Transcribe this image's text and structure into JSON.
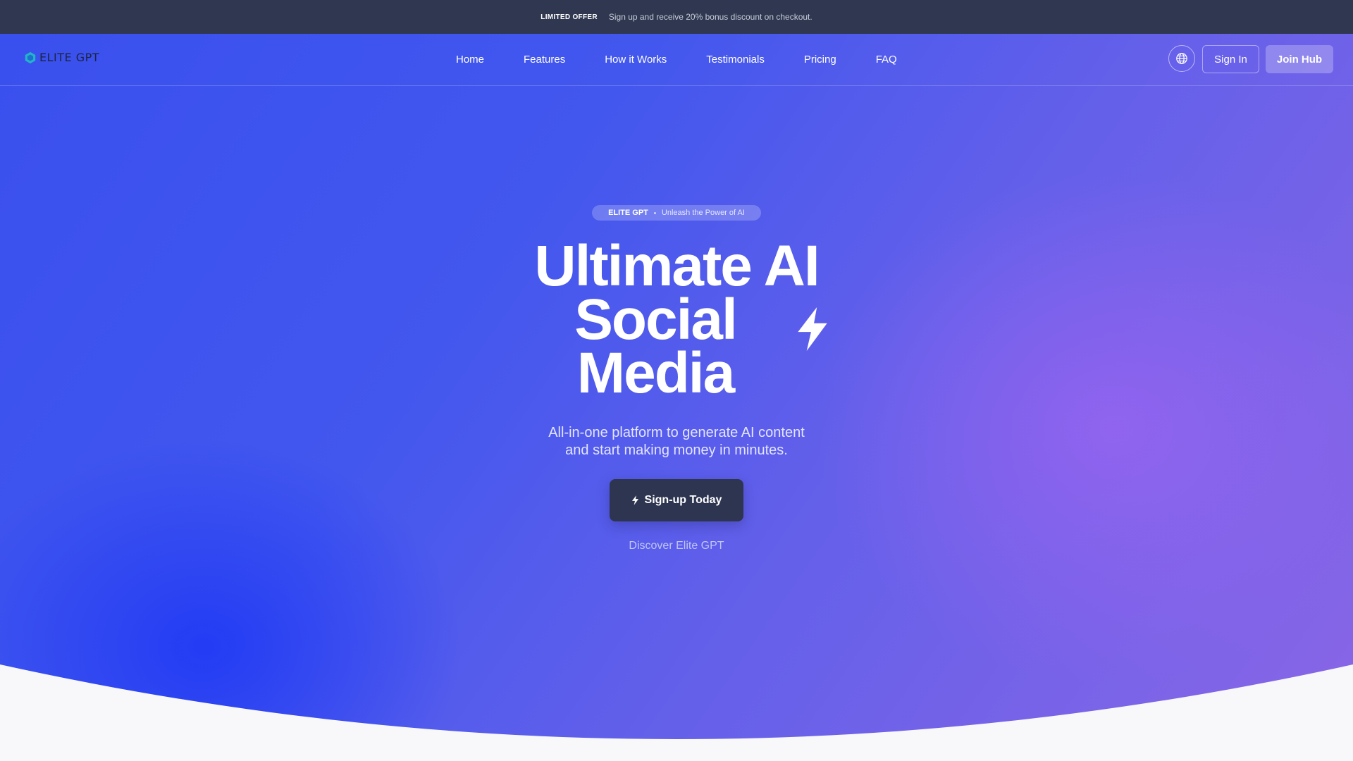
{
  "promo": {
    "tag": "LIMITED OFFER",
    "text": "Sign up and receive 20% bonus discount on checkout."
  },
  "brand": {
    "name": "ELITE GPT",
    "logo_icon": "hexagon-logo-icon"
  },
  "nav": {
    "items": [
      {
        "label": "Home"
      },
      {
        "label": "Features"
      },
      {
        "label": "How it Works"
      },
      {
        "label": "Testimonials"
      },
      {
        "label": "Pricing"
      },
      {
        "label": "FAQ"
      }
    ],
    "language_icon": "globe-icon",
    "sign_in": "Sign In",
    "join": "Join Hub"
  },
  "hero": {
    "pill_brand": "ELITE GPT",
    "pill_text": "Unleash the Power of AI",
    "headline": [
      "Ultimate AI",
      "Social",
      "Media"
    ],
    "accent_icon": "lightning-bolt-icon",
    "subtitle_line1": "All-in-one platform to generate AI content",
    "subtitle_line2": "and start making money in minutes.",
    "cta_label": "Sign-up Today",
    "cta_icon": "lightning-bolt-icon",
    "secondary_link": "Discover Elite GPT"
  },
  "colors": {
    "topbar_bg": "#2f3850",
    "hero_blue": "#3a50ee",
    "hero_purple": "#8a66e6",
    "cta_bg": "#2e3551",
    "page_bg": "#f8f8fb"
  }
}
